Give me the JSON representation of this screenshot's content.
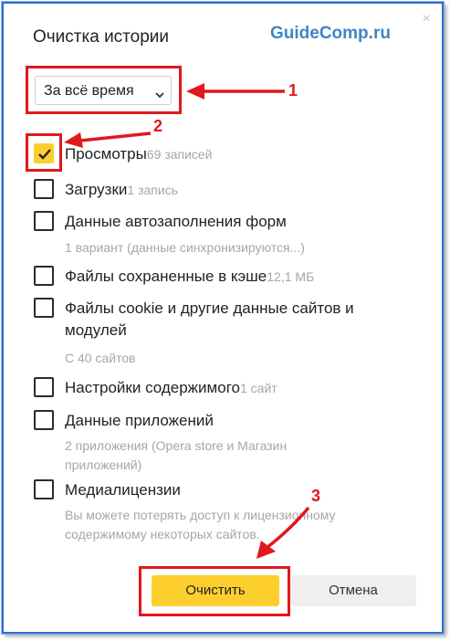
{
  "dialog": {
    "title": "Очистка истории",
    "watermark": "GuideComp.ru",
    "close_glyph": "×",
    "period": {
      "selected": "За всё время",
      "icon": "chevron-down-icon"
    },
    "items": [
      {
        "label": "Просмотры",
        "meta": "69 записей",
        "checked": true
      },
      {
        "label": "Загрузки",
        "meta": "1 запись",
        "checked": false
      },
      {
        "label": "Данные автозаполнения форм",
        "sub": "1 вариант (данные синхронизируются...)",
        "checked": false
      },
      {
        "label": "Файлы сохраненные в кэше",
        "meta": "12,1 МБ",
        "checked": false
      },
      {
        "label": "Файлы cookie и другие данные сайтов и модулей",
        "sub": "С 40 сайтов",
        "checked": false
      },
      {
        "label": "Настройки содержимого",
        "meta": "1 сайт",
        "checked": false
      },
      {
        "label": "Данные приложений",
        "sub": "2 приложения (Opera store и Магазин приложений)",
        "checked": false
      },
      {
        "label": "Медиалицензии",
        "sub": "Вы можете потерять доступ к лицензионному содержимому некоторых сайтов.",
        "checked": false
      }
    ],
    "buttons": {
      "clear": "Очистить",
      "cancel": "Отмена"
    }
  },
  "annotations": {
    "n1": "1",
    "n2": "2",
    "n3": "3",
    "color": "#e1181d"
  },
  "colors": {
    "accent_yellow": "#fccf2f",
    "frame_blue": "#2f6fd3",
    "watermark_blue": "#3d86c6",
    "muted_text": "#a6a6a6"
  }
}
